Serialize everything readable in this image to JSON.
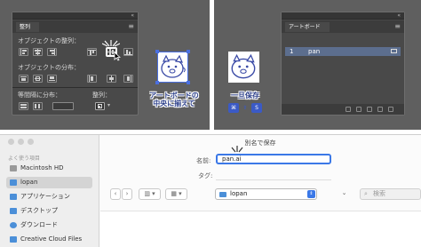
{
  "align_panel": {
    "tab_label": "整列",
    "section_align_objects": "オブジェクトの整列：",
    "section_distribute_objects": "オブジェクトの分布：",
    "section_distribute_spacing": "等間隔に分布：",
    "section_align_to": "整列："
  },
  "artboard_panel": {
    "tab_label": "アートボード",
    "rows": [
      {
        "number": "1",
        "name": "pan"
      }
    ]
  },
  "callouts": {
    "center_on_artboard": [
      "アートボードの",
      "中央に揃えて"
    ],
    "save_once": "一旦保存",
    "shortcut_keys": [
      "⌘",
      "⇧",
      "S"
    ]
  },
  "save_dialog": {
    "title": "別名で保存",
    "name_label": "名前:",
    "name_value": "pan.ai",
    "tags_label": "タグ:",
    "folder_value": "lopan",
    "search_placeholder": "検索"
  },
  "sidebar": {
    "section_title": "よく使う項目",
    "items": [
      {
        "label": "Macintosh HD",
        "icon": "disk-icon",
        "selected": false
      },
      {
        "label": "lopan",
        "icon": "folder-icon",
        "selected": true
      },
      {
        "label": "アプリケーション",
        "icon": "applications-icon",
        "selected": false
      },
      {
        "label": "デスクトップ",
        "icon": "desktop-icon",
        "selected": false
      },
      {
        "label": "ダウンロード",
        "icon": "download-icon",
        "selected": false
      },
      {
        "label": "Creative Cloud Files",
        "icon": "folder-icon",
        "selected": false
      }
    ]
  },
  "colors": {
    "panel_bg": "#494949",
    "selection_blue": "#5c6e8e",
    "accent_blue": "#3b5ac6",
    "focus_blue": "#3b78e7"
  }
}
